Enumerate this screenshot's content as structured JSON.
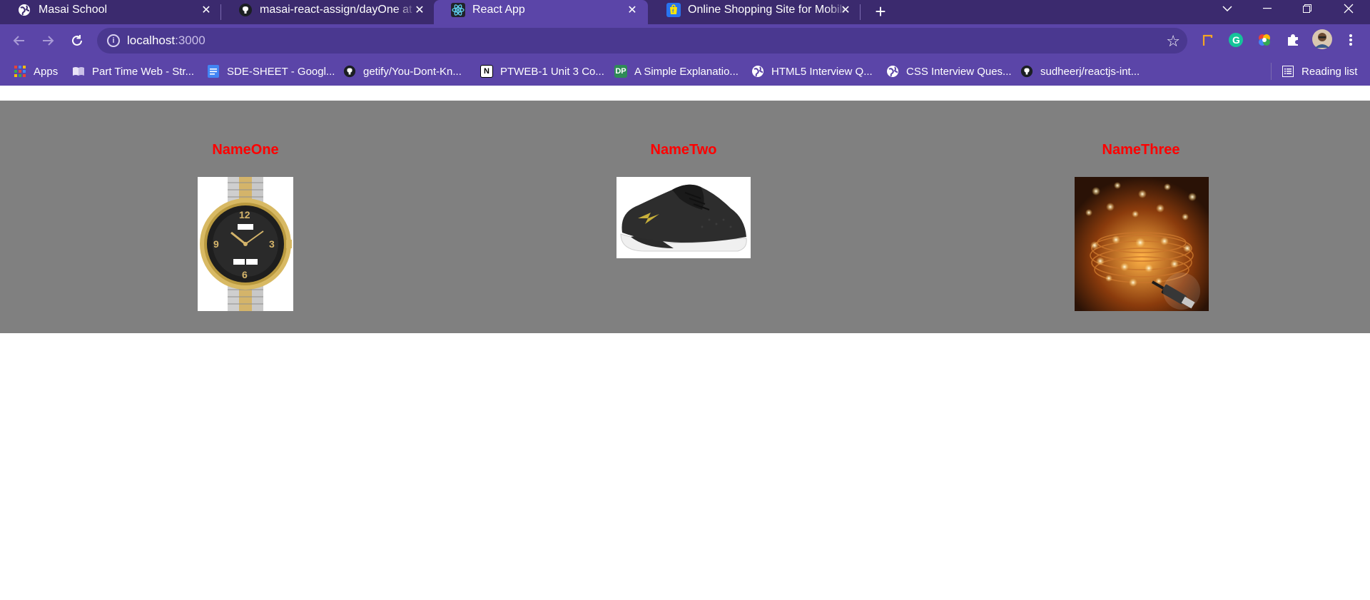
{
  "browser": {
    "tabs": [
      {
        "title": "Masai School",
        "active": false
      },
      {
        "title": "masai-react-assign/dayOne at ma",
        "active": false
      },
      {
        "title": "React App",
        "active": true
      },
      {
        "title": "Online Shopping Site for Mobiles",
        "active": false
      }
    ],
    "new_tab_glyph": "+",
    "close_glyph": "✕"
  },
  "toolbar": {
    "url_host": "localhost",
    "url_port": ":3000"
  },
  "bookmarks": {
    "items": [
      {
        "label": "Apps",
        "icon": "apps-grid-icon"
      },
      {
        "label": "Part Time Web - Str...",
        "icon": "book-icon"
      },
      {
        "label": "SDE-SHEET - Googl...",
        "icon": "google-docs-icon"
      },
      {
        "label": "getify/You-Dont-Kn...",
        "icon": "github-icon"
      },
      {
        "label": "PTWEB-1 Unit 3 Co...",
        "icon": "notion-icon"
      },
      {
        "label": "A Simple Explanatio...",
        "icon": "dp-icon"
      },
      {
        "label": "HTML5 Interview Q...",
        "icon": "globe-icon"
      },
      {
        "label": "CSS Interview Ques...",
        "icon": "globe-icon"
      },
      {
        "label": "sudheerj/reactjs-int...",
        "icon": "github-icon"
      }
    ],
    "reading_list": "Reading list",
    "dp_badge": "DP",
    "notion_badge": "N"
  },
  "products": [
    {
      "name": "NameOne",
      "image": "wristwatch-image"
    },
    {
      "name": "NameTwo",
      "image": "sneaker-image"
    },
    {
      "name": "NameThree",
      "image": "fairy-lights-image"
    }
  ],
  "colors": {
    "tabstrip": "#3b2a6e",
    "toolbar": "#5b45a8",
    "band": "#808080",
    "product_name": "#ff0000"
  }
}
